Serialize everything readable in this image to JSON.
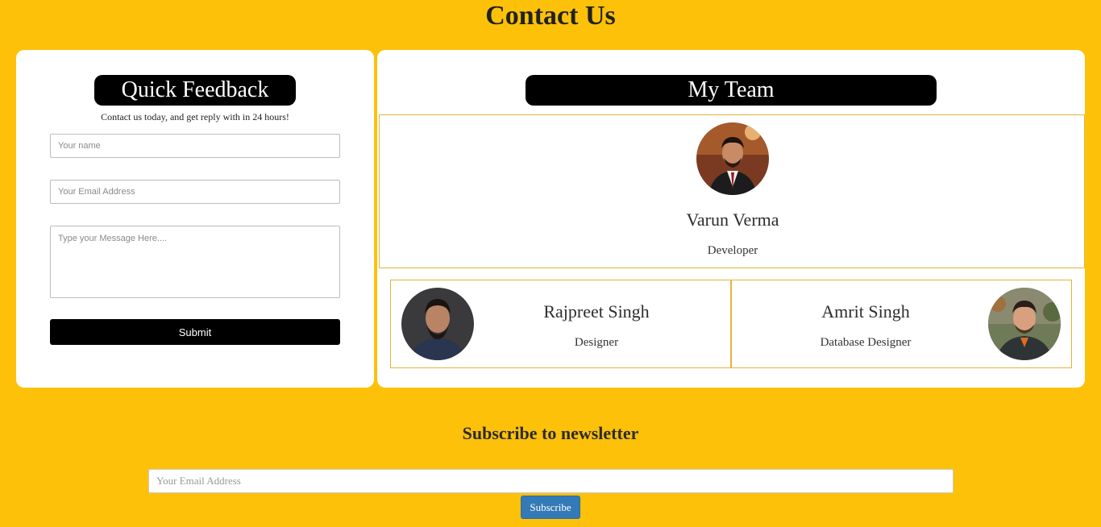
{
  "page": {
    "title": "Contact Us"
  },
  "feedback": {
    "heading": "Quick Feedback",
    "subtext": "Contact us today, and get reply with in 24 hours!",
    "name_placeholder": "Your name",
    "email_placeholder": "Your Email Address",
    "message_placeholder": "Type your Message Here....",
    "submit_label": "Submit"
  },
  "team": {
    "heading": "My Team",
    "members": [
      {
        "name": "Varun Verma",
        "role": "Developer",
        "avatar": "avatar-photo"
      },
      {
        "name": "Rajpreet Singh",
        "role": "Designer",
        "avatar": "avatar-photo"
      },
      {
        "name": "Amrit Singh",
        "role": "Database Designer",
        "avatar": "avatar-photo"
      }
    ]
  },
  "newsletter": {
    "title": "Subscribe to newsletter",
    "email_placeholder": "Your Email Address",
    "subscribe_label": "Subscribe"
  },
  "colors": {
    "background": "#fdc10a",
    "card": "#ffffff",
    "accent_dark": "#000000",
    "subscribe": "#337ab7",
    "box_border": "#e6b23a"
  }
}
